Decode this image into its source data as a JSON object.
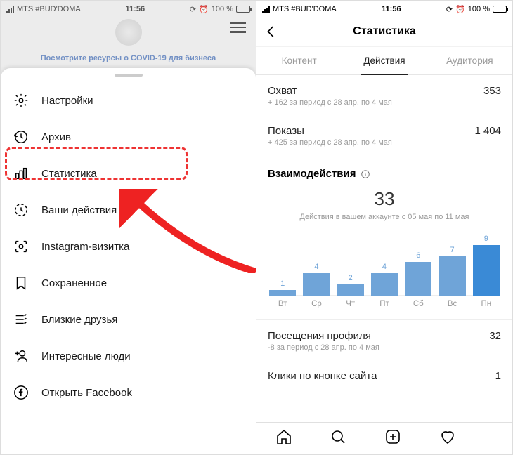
{
  "status_bar": {
    "carrier": "MTS #BUD'DOMA",
    "time": "11:56",
    "battery_pct": "100 %"
  },
  "left_phone": {
    "covid_banner": "Посмотрите ресурсы о COVID-19 для бизнеса",
    "menu": [
      {
        "id": "settings",
        "label": "Настройки"
      },
      {
        "id": "archive",
        "label": "Архив"
      },
      {
        "id": "stats",
        "label": "Статистика"
      },
      {
        "id": "activity",
        "label": "Ваши действия"
      },
      {
        "id": "nametag",
        "label": "Instagram-визитка"
      },
      {
        "id": "saved",
        "label": "Сохраненное"
      },
      {
        "id": "close-friends",
        "label": "Близкие друзья"
      },
      {
        "id": "discover-people",
        "label": "Интересные люди"
      },
      {
        "id": "open-facebook",
        "label": "Открыть Facebook"
      }
    ]
  },
  "right_phone": {
    "title": "Статистика",
    "tabs": {
      "content": "Контент",
      "actions": "Действия",
      "audience": "Аудитория"
    },
    "reach": {
      "label": "Охват",
      "value": "353",
      "sub": "+ 162 за период с 28 апр. по 4 мая"
    },
    "impressions": {
      "label": "Показы",
      "value": "1 404",
      "sub": "+ 425 за период с 28 апр. по 4 мая"
    },
    "interactions": {
      "title": "Взаимодействия",
      "big": "33",
      "sub": "Действия в вашем аккаунте с 05 мая по 11 мая"
    },
    "profile_visits": {
      "label": "Посещения профиля",
      "value": "32",
      "sub": "-8 за период с 28 апр. по 4 мая"
    },
    "site_clicks": {
      "label": "Клики по кнопке сайта",
      "value": "1"
    }
  },
  "chart_data": {
    "type": "bar",
    "title": "Взаимодействия",
    "ylabel": "Действия",
    "ylim": [
      0,
      9
    ],
    "categories": [
      "Вт",
      "Ср",
      "Чт",
      "Пт",
      "Сб",
      "Вс",
      "Пн"
    ],
    "values": [
      1,
      4,
      2,
      4,
      6,
      7,
      9
    ]
  }
}
